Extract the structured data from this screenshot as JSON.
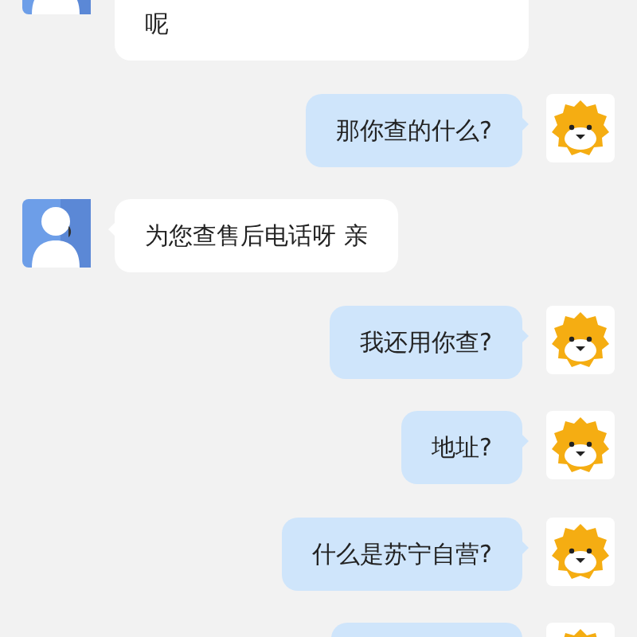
{
  "messages": [
    {
      "kind": "agent",
      "text": "呢"
    },
    {
      "kind": "user",
      "text": "那你查的什么?"
    },
    {
      "kind": "agent",
      "text": "为您查售后电话呀 亲"
    },
    {
      "kind": "user",
      "text": "我还用你查?"
    },
    {
      "kind": "user",
      "text": "地址?"
    },
    {
      "kind": "user",
      "text": "什么是苏宁自营?"
    },
    {
      "kind": "user"
    }
  ]
}
